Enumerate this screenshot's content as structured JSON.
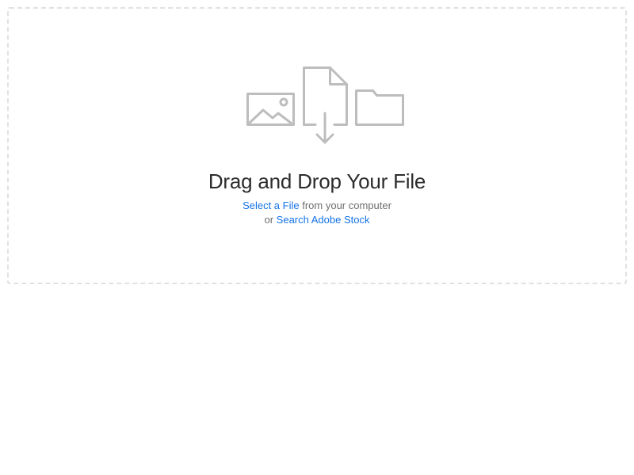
{
  "dropzone": {
    "icons": [
      "image-icon",
      "file-download-icon",
      "folder-icon"
    ],
    "title": "Drag and Drop Your File",
    "select_link": "Select a File",
    "select_suffix": " from your computer",
    "or_prefix": "or ",
    "stock_link": "Search Adobe Stock"
  },
  "colors": {
    "link": "#1473e6",
    "muted_text": "#6e6e6e",
    "title_text": "#2c2c2c",
    "icon_stroke": "#bdbdbd",
    "border": "#e1e1e1"
  }
}
